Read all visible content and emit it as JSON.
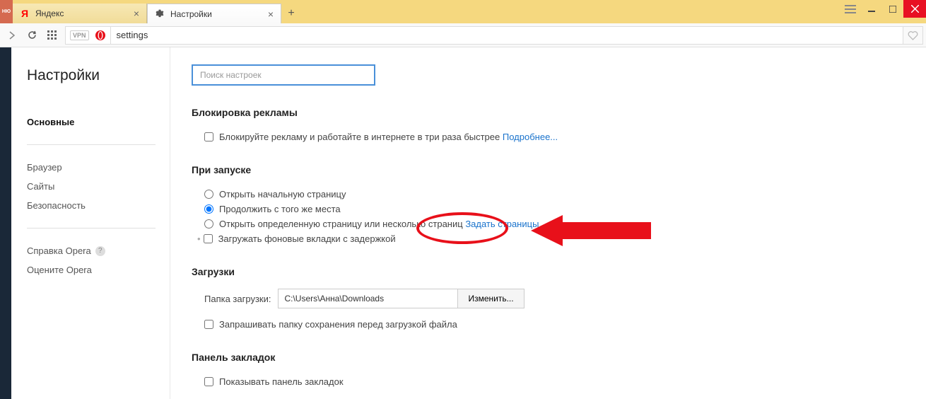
{
  "titlebar": {
    "menu_label": "НЮ"
  },
  "tabs": [
    {
      "title": "Яндекс",
      "icon": "yandex",
      "active": false
    },
    {
      "title": "Настройки",
      "icon": "gear",
      "active": true
    }
  ],
  "address_bar": {
    "vpn_label": "VPN",
    "url": "settings"
  },
  "sidebar": {
    "title": "Настройки",
    "items": [
      {
        "label": "Основные",
        "active": true
      },
      {
        "label": "Браузер",
        "active": false
      },
      {
        "label": "Сайты",
        "active": false
      },
      {
        "label": "Безопасность",
        "active": false
      }
    ],
    "footer_items": [
      {
        "label": "Справка Opera",
        "has_help": true
      },
      {
        "label": "Оцените Opera",
        "has_help": false
      }
    ]
  },
  "main": {
    "search_placeholder": "Поиск настроек",
    "sections": {
      "adblock": {
        "title": "Блокировка рекламы",
        "checkbox_label": "Блокируйте рекламу и работайте в интернете в три раза быстрее",
        "link": "Подробнее..."
      },
      "startup": {
        "title": "При запуске",
        "radio1": "Открыть начальную страницу",
        "radio2": "Продолжить с того же места",
        "radio3": "Открыть определенную страницу или несколько страниц",
        "radio3_link": "Задать страницы",
        "checkbox": "Загружать фоновые вкладки с задержкой"
      },
      "downloads": {
        "title": "Загрузки",
        "folder_label": "Папка загрузки:",
        "folder_path": "C:\\Users\\Анна\\Downloads",
        "change_button": "Изменить...",
        "ask_checkbox": "Запрашивать папку сохранения перед загрузкой файла"
      },
      "bookmarks": {
        "title": "Панель закладок",
        "show_checkbox": "Показывать панель закладок"
      }
    }
  }
}
